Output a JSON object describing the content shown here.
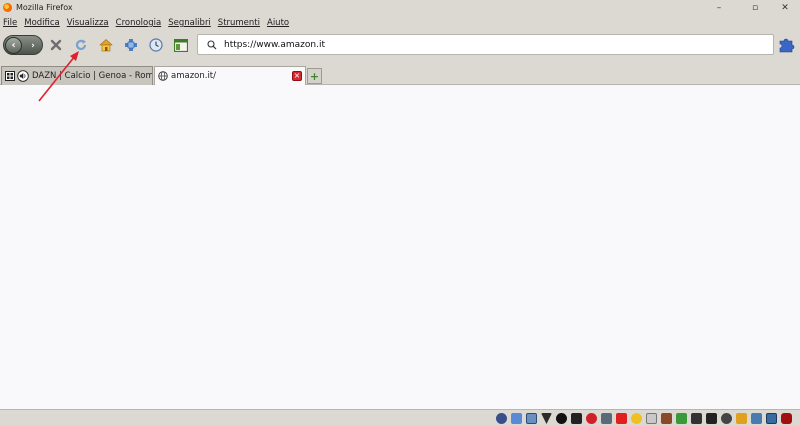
{
  "window": {
    "title": "Mozilla Firefox",
    "minimize": "–",
    "maximize": "▫",
    "close": "✕"
  },
  "menu": [
    "File",
    "Modifica",
    "Visualizza",
    "Cronologia",
    "Segnalibri",
    "Strumenti",
    "Aiuto"
  ],
  "navbar": {
    "back": "‹",
    "forward": "›",
    "url": "https://www.amazon.it"
  },
  "tabs": [
    {
      "label": "DAZN | Calcio | Genoa - Roma",
      "audio": true
    },
    {
      "label": "amazon.it/",
      "active": true
    }
  ],
  "new_tab": "+",
  "status_icons": [
    "cursor-icon",
    "link-icon",
    "grid-icon",
    "filter-icon",
    "block-icon",
    "media-icon",
    "plus-red-icon",
    "pen-icon",
    "yandex-icon",
    "smiley-icon",
    "clipboard-icon",
    "chain-icon",
    "add-icon",
    "puzzle-icon",
    "screenshot-icon",
    "clock-icon",
    "v-icon",
    "image-icon",
    "save-icon",
    "ublock-icon"
  ],
  "colors": {
    "chrome": "#dcd9d2",
    "content": "#f9f9fb",
    "tab_close": "#d8262e",
    "annotation": "#e0202a"
  }
}
